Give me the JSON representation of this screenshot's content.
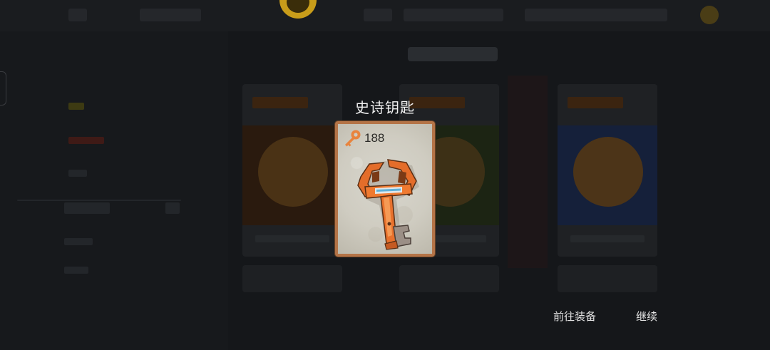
{
  "reward": {
    "title": "史诗钥匙",
    "count": "188",
    "count_icon": "key-icon",
    "item_icon": "epic-key-icon",
    "frame_color": "#b57447",
    "accent_color": "#e8712c"
  },
  "actions": {
    "equip_label": "前往装备",
    "continue_label": "继续"
  }
}
